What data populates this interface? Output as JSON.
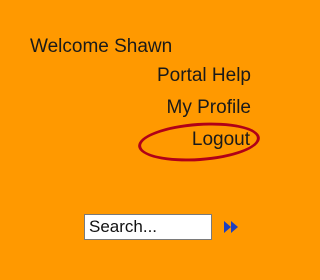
{
  "welcome_text": "Welcome Shawn",
  "links": {
    "portal_help": "Portal Help",
    "my_profile": "My Profile",
    "logout": "Logout"
  },
  "search": {
    "placeholder": "Search...",
    "value": ""
  },
  "icons": {
    "go": "double-chevron-right-icon"
  },
  "colors": {
    "background": "#ff9900",
    "highlight_circle": "#b00018",
    "go_icon": "#1f3fbf"
  }
}
